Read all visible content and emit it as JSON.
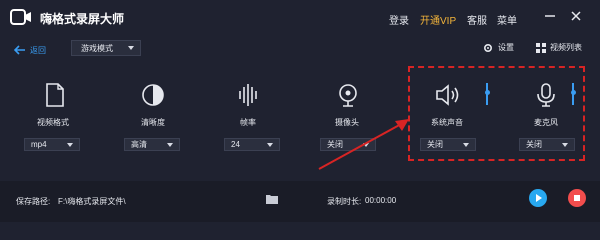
{
  "titlebar": {
    "app_title": "嗨格式录屏大师",
    "login": "登录",
    "vip": "开通VIP",
    "customer_service": "客服",
    "menu": "菜单"
  },
  "toolbar": {
    "back_label": "返回",
    "mode_select": "游戏模式",
    "settings_label": "设置",
    "video_list_label": "视频列表"
  },
  "options": {
    "video_format": {
      "label": "视频格式",
      "value": "mp4"
    },
    "clarity": {
      "label": "清晰度",
      "value": "高清"
    },
    "frame_rate": {
      "label": "帧率",
      "value": "24"
    },
    "camera": {
      "label": "摄像头",
      "value": "关闭"
    },
    "system_sound": {
      "label": "系统声音",
      "value": "关闭"
    },
    "microphone": {
      "label": "麦克风",
      "value": "关闭"
    }
  },
  "bottom": {
    "save_path_label": "保存路径:",
    "save_path_value": "F:\\嗨格式录屏文件\\",
    "record_time_label": "录制时长:",
    "record_time_value": "00:00:00"
  },
  "colors": {
    "accent": "#3a9df2",
    "vip": "#f3b43a",
    "highlight_box": "#d72424",
    "play": "#28a8f0",
    "stop": "#f24d4d"
  }
}
